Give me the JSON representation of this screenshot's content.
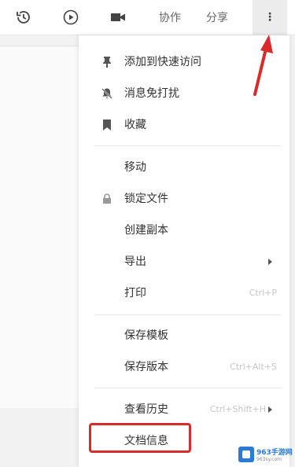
{
  "toolbar": {
    "history_icon": "history-icon",
    "play_icon": "play-icon",
    "video_icon": "video-icon",
    "collaborate_label": "协作",
    "share_label": "分享",
    "more_label": "⋮"
  },
  "menu": {
    "items": [
      {
        "label": "添加到快速访问",
        "icon": "pin-icon"
      },
      {
        "label": "消息免打扰",
        "icon": "bell-off-icon"
      },
      {
        "label": "收藏",
        "icon": "bookmark-icon"
      },
      {
        "label": "移动",
        "icon": ""
      },
      {
        "label": "锁定文件",
        "icon": "lock-icon"
      },
      {
        "label": "创建副本",
        "icon": ""
      },
      {
        "label": "导出",
        "icon": "",
        "submenu": true
      },
      {
        "label": "打印",
        "shortcut": "Ctrl+P"
      },
      {
        "label": "保存模板",
        "icon": ""
      },
      {
        "label": "保存版本",
        "shortcut": "Ctrl+Alt+S"
      },
      {
        "label": "查看历史",
        "shortcut": "Ctrl+Shift+H",
        "submenu": true
      },
      {
        "label": "文档信息",
        "icon": ""
      }
    ]
  },
  "watermark": {
    "brand": "963手游网",
    "sub": "963sy.com"
  },
  "colors": {
    "highlight": "#d92b2b",
    "arrow": "#d92b2b"
  }
}
